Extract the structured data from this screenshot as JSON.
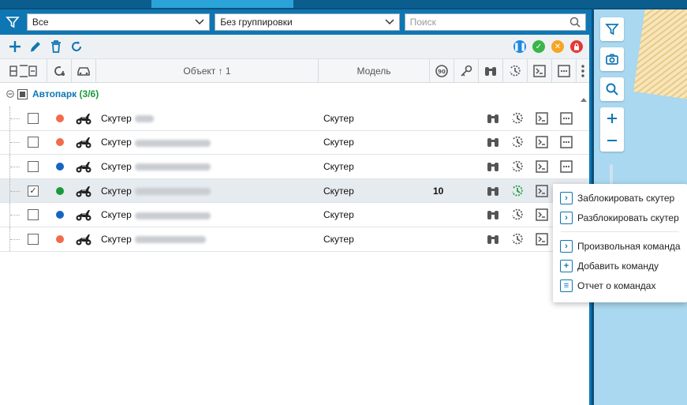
{
  "filters": {
    "status_value": "Все",
    "grouping_value": "Без группировки",
    "search_placeholder": "Поиск"
  },
  "columns": {
    "object": "Объект ↑ 1",
    "model": "Модель"
  },
  "group": {
    "name": "Автопарк",
    "count": "(3/6)"
  },
  "rows": [
    {
      "name": "Скутер",
      "model": "Скутер",
      "speed": "",
      "status_color": "#f26b4a",
      "checked": false,
      "selected": false,
      "history_active": false
    },
    {
      "name": "Скутер",
      "model": "Скутер",
      "speed": "",
      "status_color": "#f26b4a",
      "checked": false,
      "selected": false,
      "history_active": false
    },
    {
      "name": "Скутер",
      "model": "Скутер",
      "speed": "",
      "status_color": "#1565c0",
      "checked": false,
      "selected": false,
      "history_active": false
    },
    {
      "name": "Скутер",
      "model": "Скутер",
      "speed": "10",
      "status_color": "#1a9a3a",
      "checked": true,
      "selected": true,
      "history_active": true
    },
    {
      "name": "Скутер",
      "model": "Скутер",
      "speed": "",
      "status_color": "#1565c0",
      "checked": false,
      "selected": false,
      "history_active": false
    },
    {
      "name": "Скутер",
      "model": "Скутер",
      "speed": "",
      "status_color": "#f26b4a",
      "checked": false,
      "selected": false,
      "history_active": false
    }
  ],
  "context_menu": {
    "items": [
      {
        "label": "Заблокировать скутер",
        "icon": "terminal-icon"
      },
      {
        "label": "Разблокировать скутер",
        "icon": "terminal-icon"
      },
      {
        "label": "Произвольная команда",
        "icon": "terminal-icon"
      },
      {
        "label": "Добавить команду",
        "icon": "plus-box-icon"
      },
      {
        "label": "Отчет о командах",
        "icon": "report-icon"
      }
    ]
  },
  "colors": {
    "accent": "#0e76b3",
    "status_blue": "#1e88e5",
    "status_green": "#3bb54a",
    "status_orange": "#f5a623",
    "status_red": "#e53935"
  }
}
